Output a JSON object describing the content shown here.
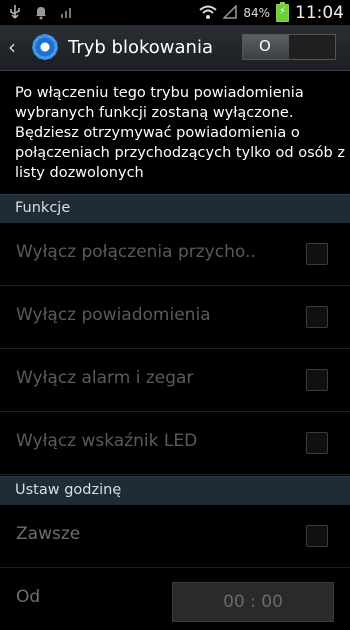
{
  "status_bar": {
    "battery_percent": "84%",
    "time": "11:04",
    "icons": [
      "usb-icon",
      "notification-bell-icon",
      "signal-bars-icon",
      "wifi-icon",
      "no-signal-icon",
      "battery-icon"
    ]
  },
  "action_bar": {
    "title": "Tryb blokowania",
    "toggle_label": "O"
  },
  "description": "Po włączeniu tego trybu powiadomienia wybranych funkcji zostaną wyłączone. Będziesz otrzymywać powiadomienia o połączeniach przychodzących tylko od osób z listy dozwolonych",
  "sections": {
    "features": {
      "title": "Funkcje",
      "items": [
        {
          "label": "Wyłącz połączenia przycho..",
          "checked": false
        },
        {
          "label": "Wyłącz powiadomienia",
          "checked": false
        },
        {
          "label": "Wyłącz alarm i zegar",
          "checked": false
        },
        {
          "label": "Wyłącz wskaźnik LED",
          "checked": false
        }
      ]
    },
    "schedule": {
      "title": "Ustaw godzinę",
      "always_label": "Zawsze",
      "from_label": "Od",
      "from_value": "00 : 00"
    }
  }
}
